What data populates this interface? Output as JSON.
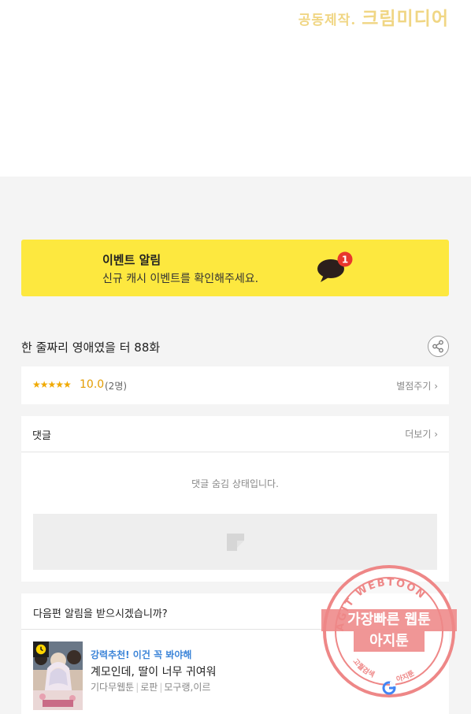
{
  "credit": {
    "prefix": "공동제작.",
    "studio": "크림미디어"
  },
  "event": {
    "title": "이벤트 알림",
    "subtitle": "신규 캐시 이벤트를 확인해주세요.",
    "badge_count": "1"
  },
  "episode": {
    "title": "한 줄짜리 영애였을 터 88화"
  },
  "rating": {
    "stars": "★★★★★",
    "score": "10.0",
    "count": "(2명)",
    "rate_label": "별점주기 ›"
  },
  "comments": {
    "title": "댓글",
    "more_label": "더보기 ›",
    "hidden_message": "댓글 숨김 상태입니다."
  },
  "notify": {
    "title": "다음편 알림을 받으시겠습니까?",
    "recommendation": {
      "badge": "강력추천! 이건 꼭 봐야해",
      "title": "계모인데, 딸이 너무 귀여워",
      "meta": [
        "기다무웹툰",
        "로판",
        "모구랭,이르"
      ]
    }
  },
  "watermark": {
    "ring_top": "AGIT WEBTOON",
    "line1": "가장빠른 웹툰",
    "line2": "아지툰",
    "ring_left": "고퀄검색",
    "ring_right": "아지툰"
  },
  "colors": {
    "event_bg": "#fde83f",
    "badge_red": "#e8372d",
    "rec_blue": "#3b84d8",
    "star_orange": "#f0a900",
    "watermark_pink": "#ee8787"
  }
}
